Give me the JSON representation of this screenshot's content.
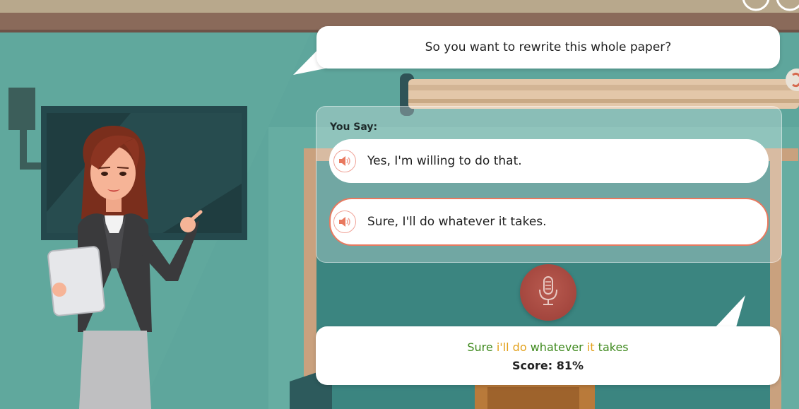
{
  "dialog": {
    "prompt": "So you want to rewrite this whole paper?",
    "you_say_label": "You Say:",
    "options": [
      {
        "text": "Yes, I'm willing to do that.",
        "selected": false
      },
      {
        "text": "Sure, I'll do whatever it takes.",
        "selected": true
      }
    ],
    "speaker_icon": "speaker-icon",
    "mic_icon": "microphone-icon"
  },
  "result": {
    "words": [
      {
        "text": "Sure",
        "status": "good"
      },
      {
        "text": "i'll",
        "status": "mid"
      },
      {
        "text": "do",
        "status": "mid"
      },
      {
        "text": "whatever",
        "status": "good"
      },
      {
        "text": "it",
        "status": "mid"
      },
      {
        "text": "takes",
        "status": "good"
      }
    ],
    "score_label": "Score:",
    "score_value": "81%"
  },
  "colors": {
    "good": "#3f8a1e",
    "mid": "#e2a01a",
    "accent": "#e8795f",
    "mic": "#a84a42"
  }
}
